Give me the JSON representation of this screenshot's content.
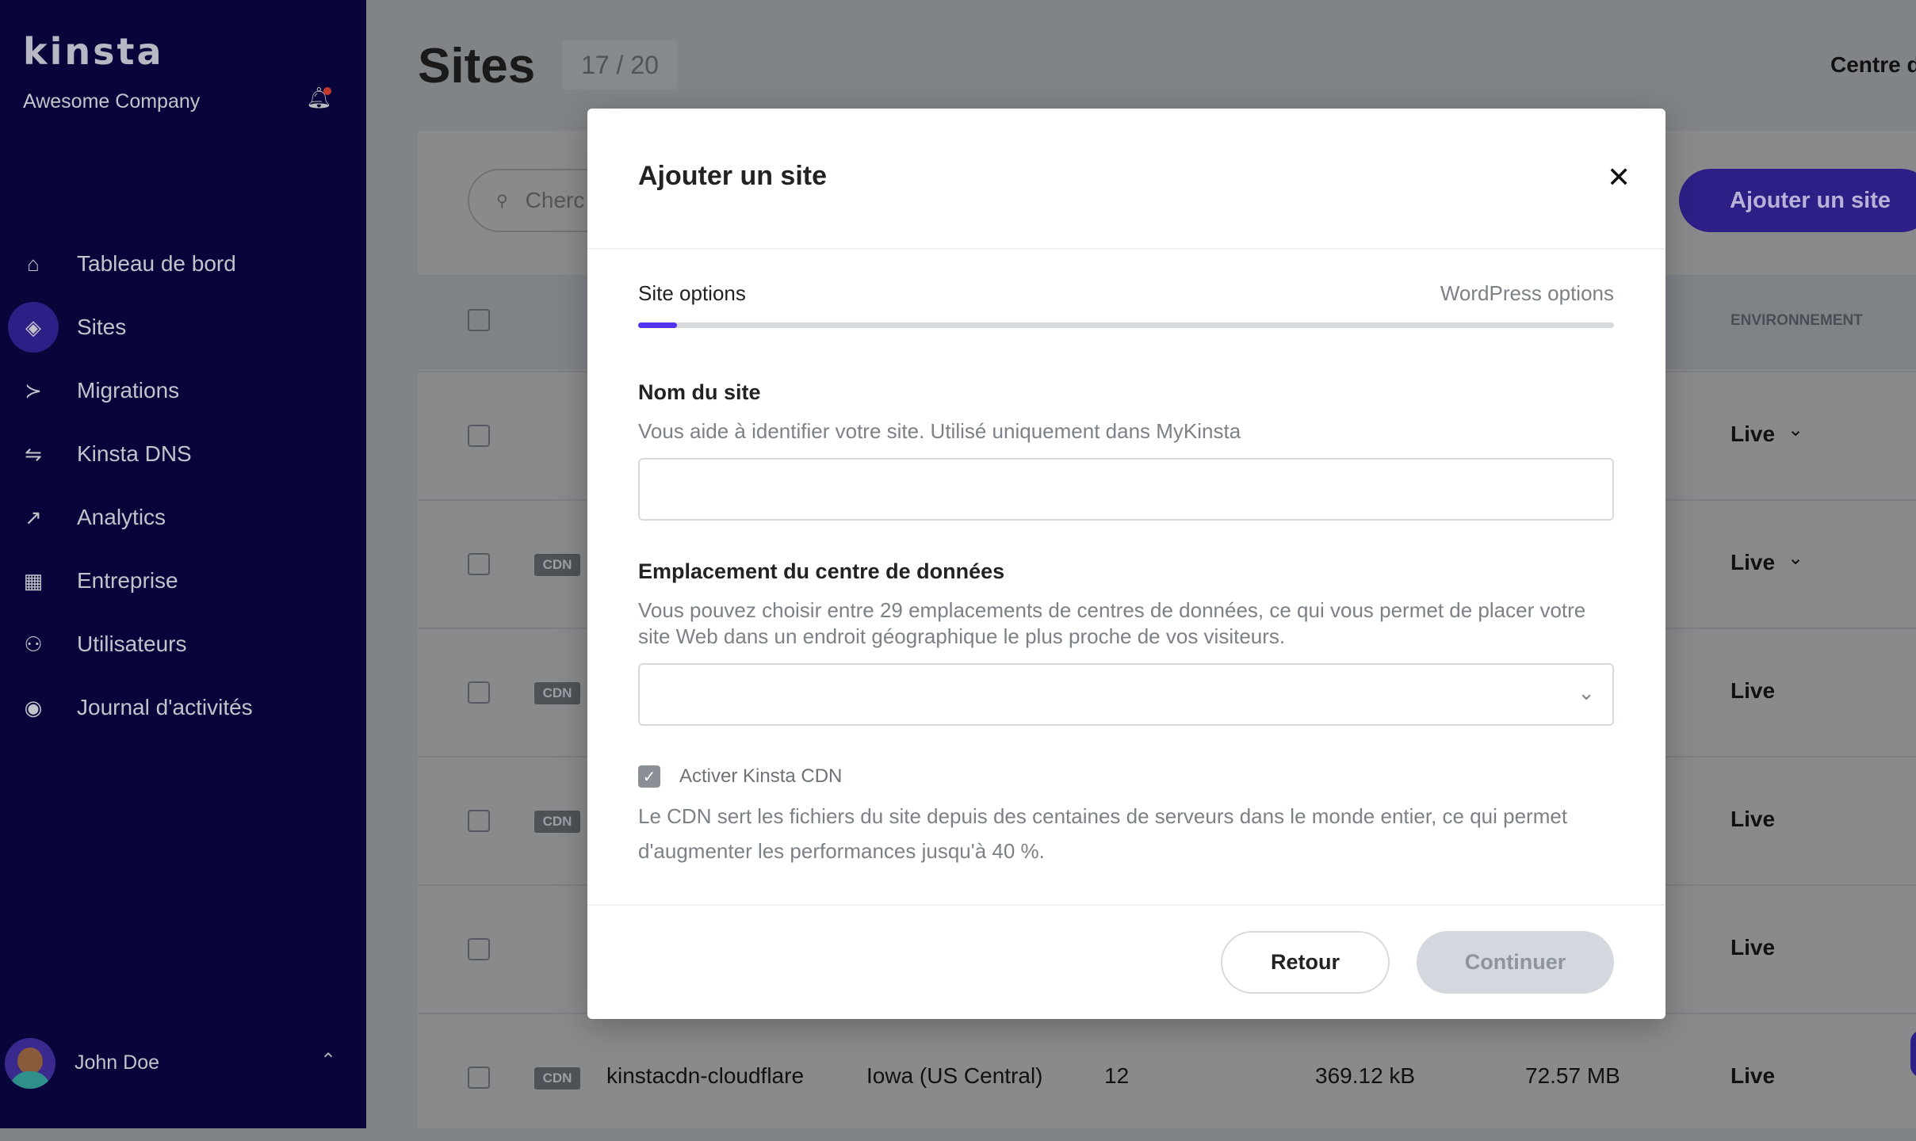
{
  "sidebar": {
    "logo": "KINSTA",
    "company": "Awesome Company",
    "items": [
      {
        "label": "Tableau de bord",
        "icon": "home-icon"
      },
      {
        "label": "Sites",
        "icon": "layers-icon",
        "active": true
      },
      {
        "label": "Migrations",
        "icon": "migrate-icon"
      },
      {
        "label": "Kinsta DNS",
        "icon": "dns-icon"
      },
      {
        "label": "Analytics",
        "icon": "trend-icon"
      },
      {
        "label": "Entreprise",
        "icon": "building-icon"
      },
      {
        "label": "Utilisateurs",
        "icon": "user-plus-icon"
      },
      {
        "label": "Journal d'activités",
        "icon": "eye-icon"
      }
    ],
    "user": "John Doe"
  },
  "header": {
    "title": "Sites",
    "count": "17 / 20",
    "help": "Centre d'"
  },
  "toolbar": {
    "search_placeholder": "Cherc",
    "add_label": "Ajouter un site"
  },
  "table": {
    "env_header": "ENVIRONNEMENT",
    "cdn_label": "CDN",
    "rows": [
      {
        "cdn": false,
        "env": "Live",
        "dropdown": true
      },
      {
        "cdn": true,
        "env": "Live",
        "dropdown": true
      },
      {
        "cdn": true,
        "env": "Live"
      },
      {
        "cdn": true,
        "env": "Live"
      },
      {
        "cdn": false,
        "env": "Live"
      },
      {
        "cdn": true,
        "name": "kinstacdn-cloudflare",
        "location": "Iowa (US Central)",
        "visits": "12",
        "bandwidth": "369.12 kB",
        "disk": "72.57 MB",
        "env": "Live"
      }
    ]
  },
  "modal": {
    "title": "Ajouter un site",
    "steps": [
      "Site options",
      "WordPress options"
    ],
    "progress_percent": 4,
    "site_name_label": "Nom du site",
    "site_name_help": "Vous aide à identifier votre site. Utilisé uniquement dans MyKinsta",
    "site_name_value": "",
    "location_label": "Emplacement du centre de données",
    "location_help": "Vous pouvez choisir entre 29 emplacements de centres de données, ce qui vous permet de placer votre site Web dans un endroit géographique le plus proche de vos visiteurs.",
    "location_value": "",
    "cdn_checkbox_label": "Activer Kinsta CDN",
    "cdn_checked": true,
    "cdn_help": "Le CDN sert les fichiers du site depuis des centaines de serveurs dans le monde entier, ce qui permet d'augmenter les performances jusqu'à 40 %.",
    "back_label": "Retour",
    "continue_label": "Continuer"
  },
  "colors": {
    "accent": "#5333ed",
    "sidebar": "#07053a"
  }
}
